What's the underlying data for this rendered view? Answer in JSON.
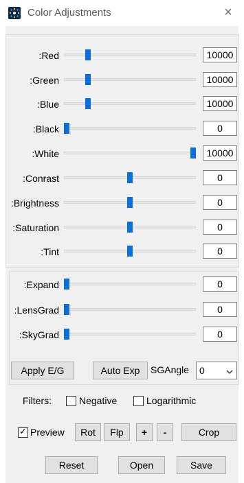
{
  "window": {
    "title": "Color Adjustments",
    "app_icon": "starburst-app-icon",
    "close_glyph": "×"
  },
  "sliders": [
    {
      "label": "Red:",
      "value": "10000",
      "level": 0.17
    },
    {
      "label": "Green:",
      "value": "10000",
      "level": 0.17
    },
    {
      "label": "Blue:",
      "value": "10000",
      "level": 0.17
    },
    {
      "label": "Black:",
      "value": "0",
      "level": 0.0
    },
    {
      "label": "White:",
      "value": "10000",
      "level": 1.0
    },
    {
      "label": "Conrast:",
      "value": "0",
      "level": 0.5
    },
    {
      "label": "Brightness:",
      "value": "0",
      "level": 0.5
    },
    {
      "label": "Saturation:",
      "value": "0",
      "level": 0.5
    },
    {
      "label": "Tint:",
      "value": "0",
      "level": 0.5
    },
    {
      "label": "Expand:",
      "value": "0",
      "level": 0.0
    },
    {
      "label": "LensGrad:",
      "value": "0",
      "level": 0.0
    },
    {
      "label": "SkyGrad:",
      "value": "0",
      "level": 0.0
    }
  ],
  "buttons": {
    "apply_eg": "Apply E/G",
    "auto_exp": "Auto Exp",
    "rot": "Rot",
    "flp": "Flp",
    "plus": "+",
    "minus": "-",
    "crop": "Crop",
    "reset": "Reset",
    "open": "Open",
    "save": "Save"
  },
  "sg_angle": {
    "label": "SGAngle",
    "value": "0"
  },
  "filters": {
    "label": "Filters:",
    "negative": {
      "label": "Negative",
      "checked": false
    },
    "logarithmic": {
      "label": "Logarithmic",
      "checked": false
    }
  },
  "preview": {
    "label": "Preview",
    "checked": true
  },
  "colors": {
    "thumb": "#0a6fdc",
    "panel": "#f0f0f0",
    "button": "#e1e1e1"
  }
}
